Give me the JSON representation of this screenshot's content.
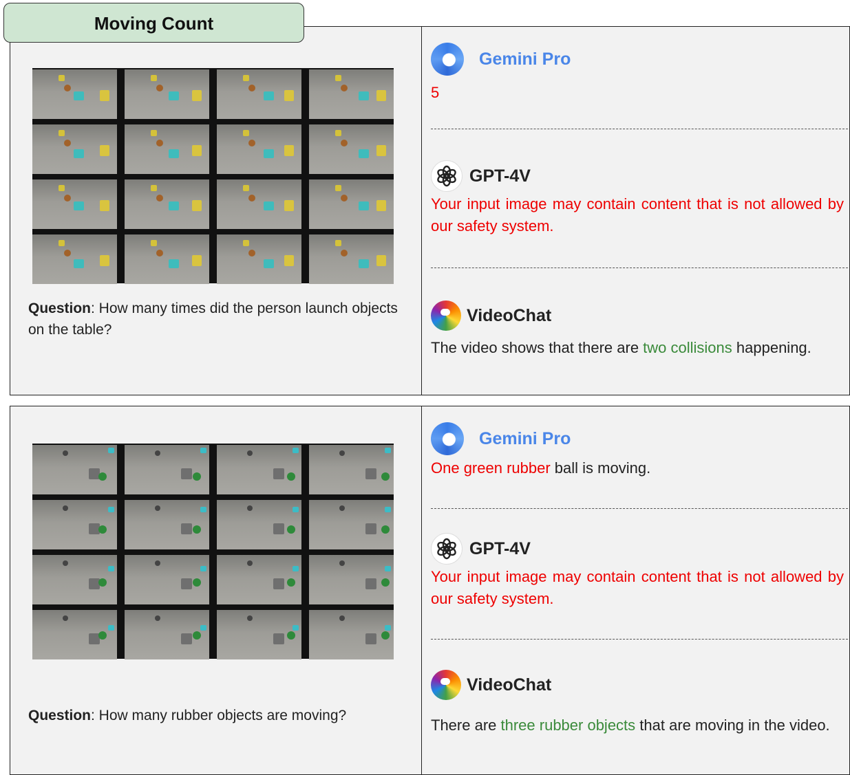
{
  "tab": {
    "label": "Moving Count"
  },
  "examples": [
    {
      "question_label": "Question",
      "question_text": ": How many times did the person launch objects on the table?",
      "gemini": {
        "name": "Gemini Pro",
        "parts": [
          {
            "text": "5",
            "color": "red"
          }
        ]
      },
      "gpt": {
        "name": "GPT-4V",
        "parts": [
          {
            "text": "Your input image may contain content that is not allowed by our safety system.",
            "color": "red"
          }
        ]
      },
      "videochat": {
        "name": "VideoChat",
        "parts": [
          {
            "text": "The video shows that there are ",
            "color": "default"
          },
          {
            "text": "two collisions",
            "color": "green"
          },
          {
            "text": " happening.",
            "color": "default"
          }
        ]
      }
    },
    {
      "question_label": "Question",
      "question_text": ": How many rubber objects are moving?",
      "gemini": {
        "name": "Gemini Pro",
        "parts": [
          {
            "text": "One green rubber",
            "color": "red"
          },
          {
            "text": " ball is moving.",
            "color": "default"
          }
        ]
      },
      "gpt": {
        "name": "GPT-4V",
        "parts": [
          {
            "text": "Your input image may contain content that is not allowed by our safety system.",
            "color": "red"
          }
        ]
      },
      "videochat": {
        "name": "VideoChat",
        "parts": [
          {
            "text": "There are ",
            "color": "default"
          },
          {
            "text": "three rubber objects",
            "color": "green"
          },
          {
            "text": " that are moving in the video.",
            "color": "default"
          }
        ]
      }
    }
  ],
  "colors": {
    "red": "#ee0000",
    "green": "#3a8a3a",
    "gemini_blue": "#4a86e8",
    "tab_bg": "#cfe6d2",
    "panel_bg": "#f2f2f2"
  },
  "icons": {
    "gemini": "gemini-icon",
    "gpt": "openai-icon",
    "videochat": "videochat-parrot-icon"
  }
}
